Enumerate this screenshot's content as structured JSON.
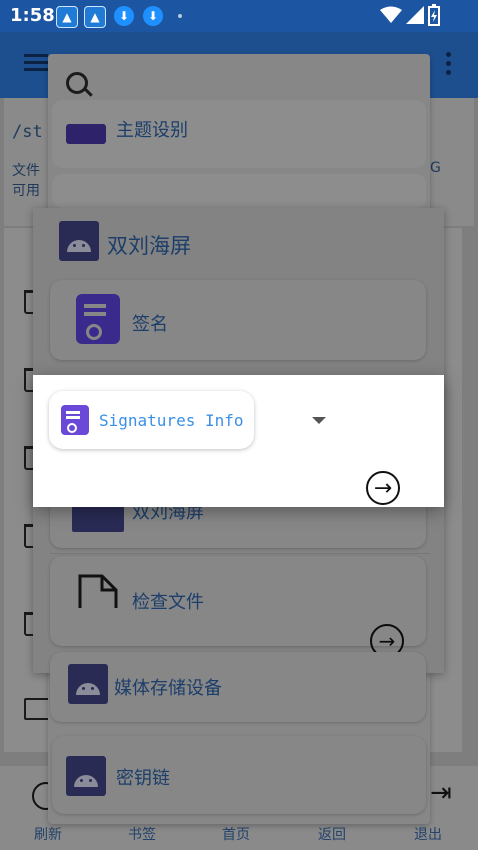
{
  "status_bar": {
    "time": "1:58",
    "icons": [
      "app-icon",
      "app-icon",
      "download-icon",
      "download-icon",
      "wifi-icon",
      "signal-icon",
      "battery-icon"
    ]
  },
  "background": {
    "path_text": "/st",
    "line1": "文件",
    "line2": "可用",
    "right_char": "G",
    "bottom_nav": [
      "刷新",
      "书签",
      "首页",
      "返回",
      "退出"
    ]
  },
  "sheet1": {
    "partial_item": "主题设别",
    "keychain_label": "密钥链"
  },
  "sheet2": {
    "title": "双刘海屏",
    "signature_label": "签名",
    "item2_label": "双刘海屏",
    "check_files_label": "检查文件",
    "media_storage_label": "媒体存储设备"
  },
  "dialog": {
    "selected_option": "Signatures Info"
  },
  "colors": {
    "status_bar": "#1c56a2",
    "accent_text": "#3a8fe8",
    "icon_purple": "#6a49d8"
  }
}
